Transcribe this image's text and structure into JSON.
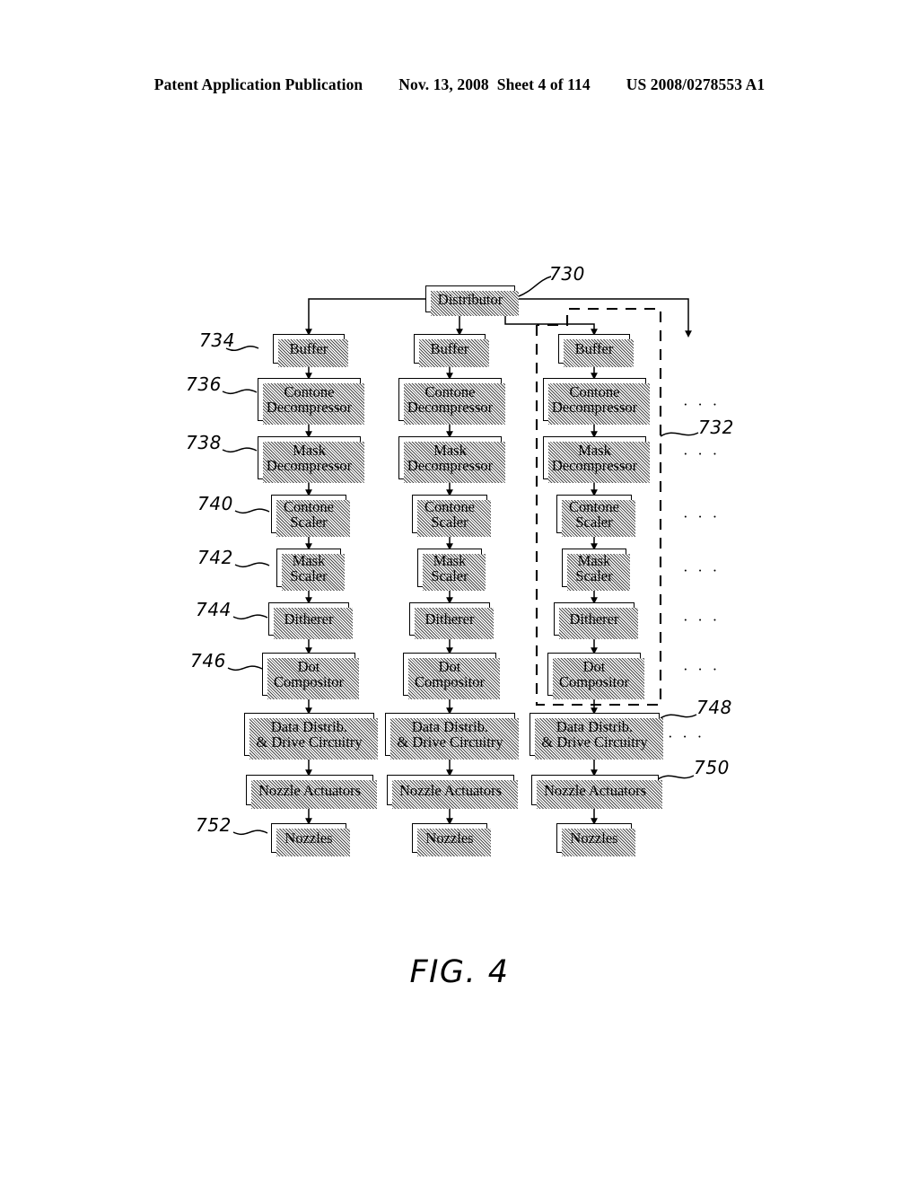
{
  "header": {
    "publication": "Patent Application Publication",
    "date": "Nov. 13, 2008",
    "sheet": "Sheet 4 of 114",
    "patent_number": "US 2008/0278553 A1"
  },
  "figure": {
    "caption": "FIG. 4",
    "distributor_label": "Distributor",
    "ellipsis": "· · ·",
    "references": [
      {
        "id": "730",
        "label": "730",
        "target": "distributor"
      },
      {
        "id": "732",
        "label": "732",
        "target": "print-engine-pipeline-group"
      },
      {
        "id": "734",
        "label": "734",
        "target": "buffer"
      },
      {
        "id": "736",
        "label": "736",
        "target": "contone-decompressor"
      },
      {
        "id": "738",
        "label": "738",
        "target": "mask-decompressor"
      },
      {
        "id": "740",
        "label": "740",
        "target": "contone-scaler"
      },
      {
        "id": "742",
        "label": "742",
        "target": "mask-scaler"
      },
      {
        "id": "744",
        "label": "744",
        "target": "ditherer"
      },
      {
        "id": "746",
        "label": "746",
        "target": "dot-compositor"
      },
      {
        "id": "748",
        "label": "748",
        "target": "data-distrib-drive-circuitry"
      },
      {
        "id": "750",
        "label": "750",
        "target": "nozzle-actuators"
      },
      {
        "id": "752",
        "label": "752",
        "target": "nozzles"
      }
    ],
    "stages": [
      {
        "key": "buffer",
        "line1": "Buffer",
        "line2": ""
      },
      {
        "key": "contone_decompressor",
        "line1": "Contone",
        "line2": "Decompressor"
      },
      {
        "key": "mask_decompressor",
        "line1": "Mask",
        "line2": "Decompressor"
      },
      {
        "key": "contone_scaler",
        "line1": "Contone",
        "line2": "Scaler"
      },
      {
        "key": "mask_scaler",
        "line1": "Mask",
        "line2": "Scaler"
      },
      {
        "key": "ditherer",
        "line1": "Ditherer",
        "line2": ""
      },
      {
        "key": "dot_compositor",
        "line1": "Dot",
        "line2": "Compositor"
      },
      {
        "key": "data_distrib",
        "line1": "Data Distrib.",
        "line2": "& Drive Circuitry"
      },
      {
        "key": "nozzle_actuators",
        "line1": "Nozzle Actuators",
        "line2": ""
      },
      {
        "key": "nozzles",
        "line1": "Nozzles",
        "line2": ""
      }
    ]
  },
  "colors": {
    "ink": "#000000",
    "paper": "#ffffff",
    "shadow": "#4a4a4a"
  }
}
